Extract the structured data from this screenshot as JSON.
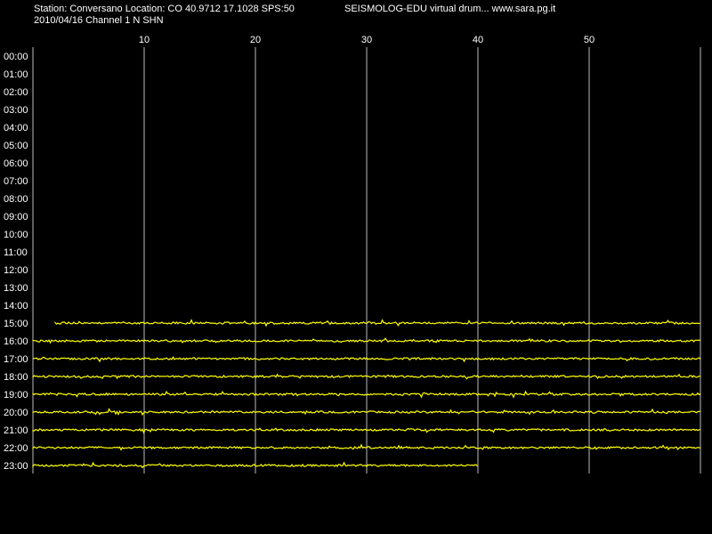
{
  "header": {
    "station_line": "Station: Conversano Location: CO 40.9712 17.1028 SPS:50",
    "software_line": "SEISMOLOG-EDU virtual drum... www.sara.pg.it",
    "date_channel_line": "2010/04/16  Channel 1 N SHN"
  },
  "chart_data": {
    "type": "line",
    "title": "",
    "xlabel": "",
    "ylabel": "",
    "x_ticks": [
      10,
      20,
      30,
      40,
      50
    ],
    "xlim": [
      0,
      60
    ],
    "grid": "vertical lines at x ticks",
    "y_tick_labels": [
      "00:00",
      "01:00",
      "02:00",
      "03:00",
      "04:00",
      "05:00",
      "06:00",
      "07:00",
      "08:00",
      "09:00",
      "10:00",
      "11:00",
      "12:00",
      "13:00",
      "14:00",
      "15:00",
      "16:00",
      "17:00",
      "18:00",
      "19:00",
      "20:00",
      "21:00",
      "22:00",
      "23:00"
    ],
    "trace_color": "#ffff00",
    "traces": [
      {
        "hour": "15:00",
        "start": 2,
        "end": 60
      },
      {
        "hour": "16:00",
        "start": 0,
        "end": 60
      },
      {
        "hour": "17:00",
        "start": 0,
        "end": 60
      },
      {
        "hour": "18:00",
        "start": 0,
        "end": 60
      },
      {
        "hour": "19:00",
        "start": 0,
        "end": 60
      },
      {
        "hour": "20:00",
        "start": 0,
        "end": 60
      },
      {
        "hour": "21:00",
        "start": 0,
        "end": 60
      },
      {
        "hour": "22:00",
        "start": 0,
        "end": 60
      },
      {
        "hour": "23:00",
        "start": 0,
        "end": 40
      }
    ]
  }
}
